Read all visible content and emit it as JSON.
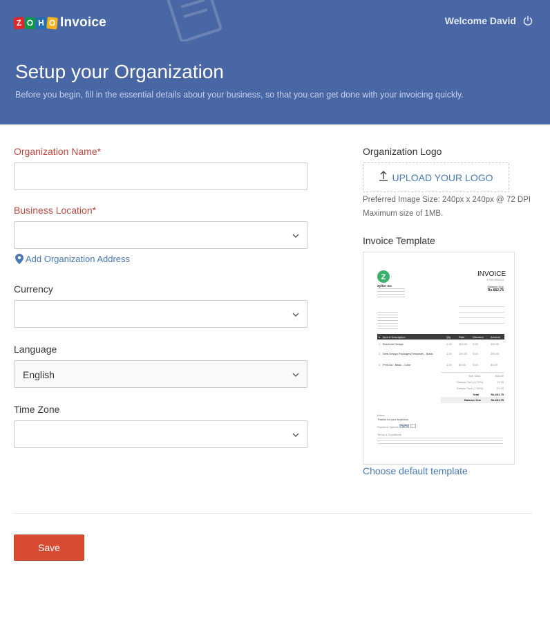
{
  "brand": {
    "letters": [
      "Z",
      "O",
      "H",
      "O"
    ],
    "letter_colors": [
      "#e42527",
      "#089949",
      "#226db4",
      "#f9b21d"
    ],
    "product": "Invoice"
  },
  "header": {
    "welcome": "Welcome David",
    "logout_icon": "power-icon",
    "title": "Setup your Organization",
    "subtitle": "Before you begin, fill in the essential details about your business, so that you can get done with your invoicing quickly."
  },
  "form": {
    "org_name": {
      "label": "Organization Name*",
      "value": ""
    },
    "business_location": {
      "label": "Business Location*",
      "value": ""
    },
    "add_address": "Add Organization Address",
    "currency": {
      "label": "Currency",
      "value": ""
    },
    "language": {
      "label": "Language",
      "value": "English"
    },
    "timezone": {
      "label": "Time Zone",
      "value": ""
    }
  },
  "logo_panel": {
    "title": "Organization Logo",
    "upload_label": "UPLOAD YOUR LOGO",
    "hint_size": "Preferred Image Size: 240px x 240px @ 72 DPI",
    "hint_max": "Maximum size of 1MB."
  },
  "template_panel": {
    "title": "Invoice Template",
    "preview": {
      "heading": "INVOICE",
      "invoice_no": "# INV-000013",
      "balance_due_label": "Balance Due",
      "balance_due_value": "Rs.662.75",
      "company": "Zylker Inc",
      "table_header": [
        "#",
        "Item & Description",
        "Qty",
        "Rate",
        "Discount",
        "Amount"
      ],
      "rows": [
        [
          "1",
          "Brochure Design",
          "1.00",
          "300.00",
          "0.00",
          "300.00"
        ],
        [
          "2",
          "Web Design Packages(Template) - Basic",
          "1.00",
          "250.00",
          "0.00",
          "250.00"
        ],
        [
          "3",
          "Print Ad - Basic - Color",
          "1.00",
          "80.00",
          "0.00",
          "80.00"
        ]
      ],
      "sub_total_label": "Sub Total",
      "sub_total": "630.00",
      "tax1_label": "Sample Tax1 (4.70%)",
      "tax1": "11.75",
      "tax2_label": "Sample Tax2 (7.00%)",
      "tax2": "21.00",
      "total_label": "Total",
      "total": "Rs.662.75",
      "balance_label": "Balance Due",
      "balance": "Rs.662.75",
      "notes_label": "Notes",
      "notes": "Thanks for your business.",
      "payment_label": "Payment Options",
      "paypal": "PayPal",
      "terms_label": "Terms & Conditions"
    },
    "choose_default": "Choose default template"
  },
  "actions": {
    "save": "Save"
  },
  "colors": {
    "header_bg": "#4a67a5",
    "required_label": "#b8493c",
    "link": "#4a78b5",
    "save_bg": "#d94a32"
  }
}
